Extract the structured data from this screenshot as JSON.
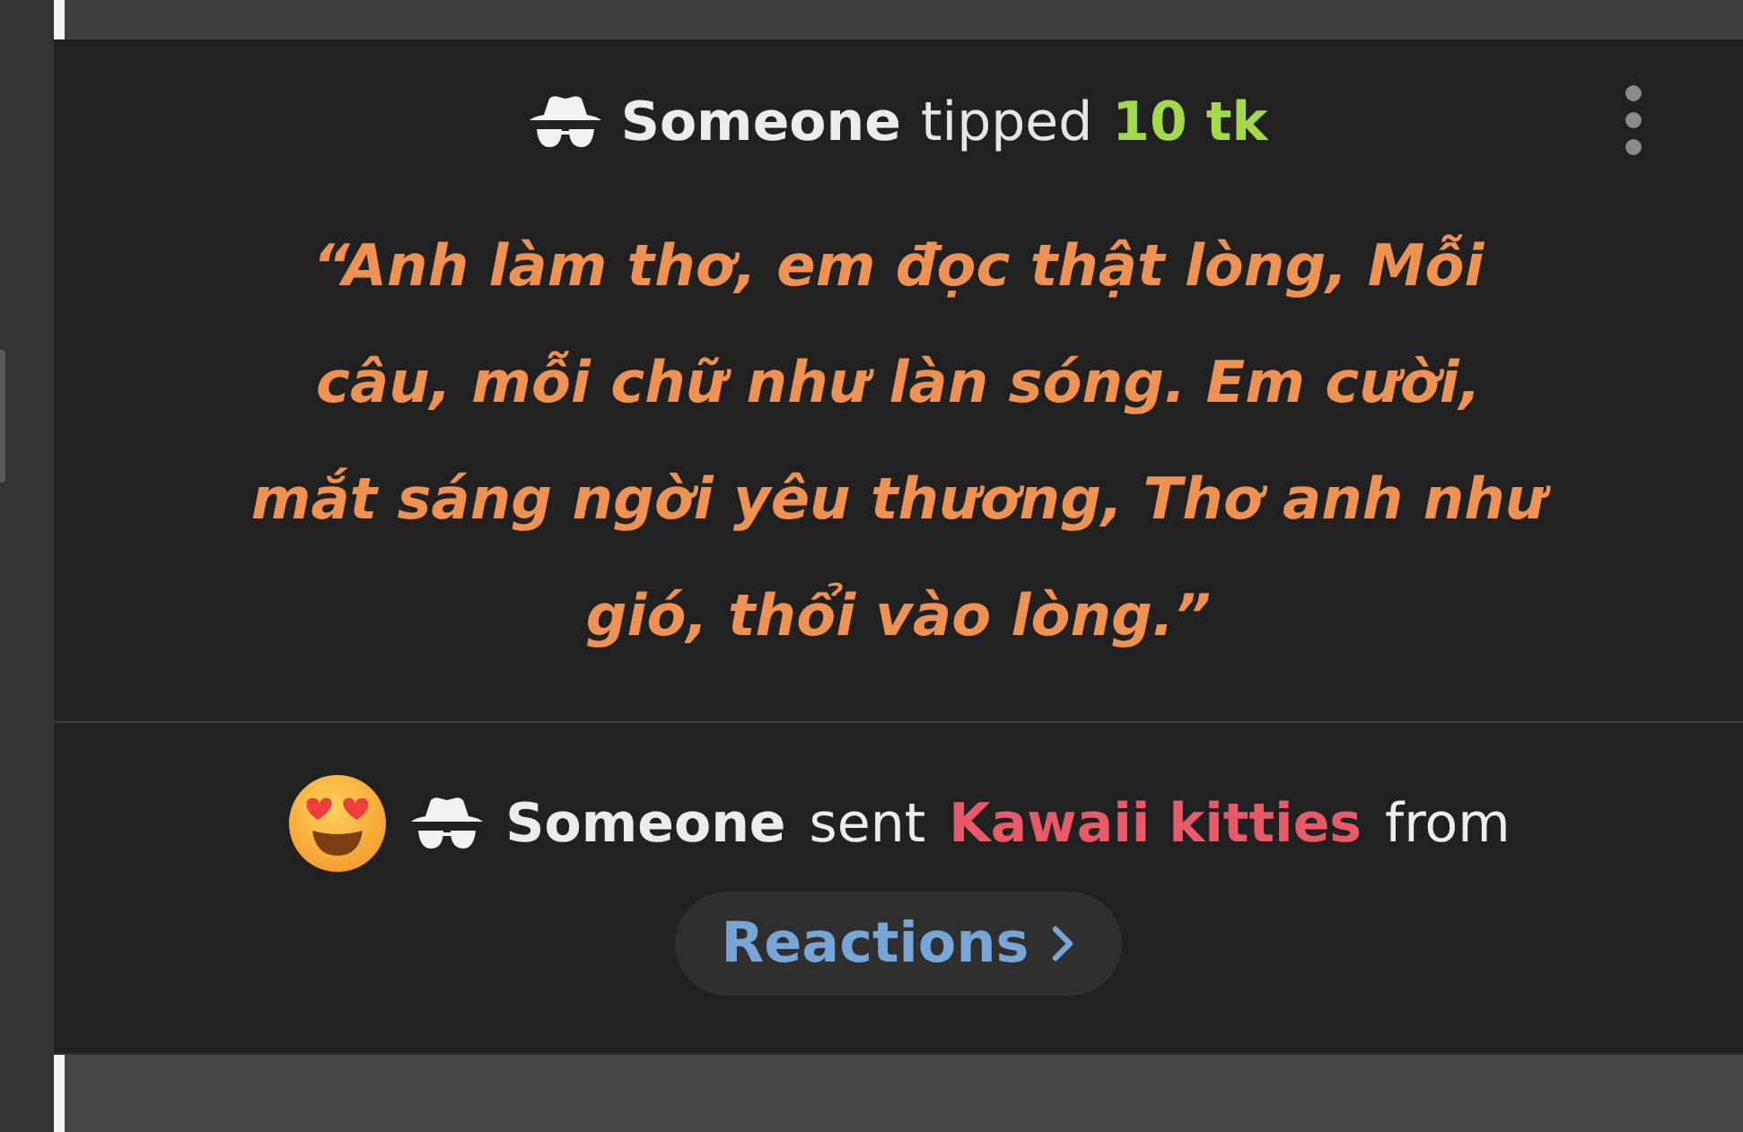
{
  "tip": {
    "sender": "Someone",
    "action": "tipped",
    "amount": "10 tk",
    "message": "“Anh làm thơ, em đọc thật lòng, Mỗi câu, mỗi chữ như làn sóng. Em cười, mắt sáng ngời yêu thương, Thơ anh như gió, thổi vào lòng.”"
  },
  "gift": {
    "sender": "Someone",
    "action": "sent",
    "item": "Kawaii kitties",
    "preposition": "from",
    "source": "Reactions"
  }
}
